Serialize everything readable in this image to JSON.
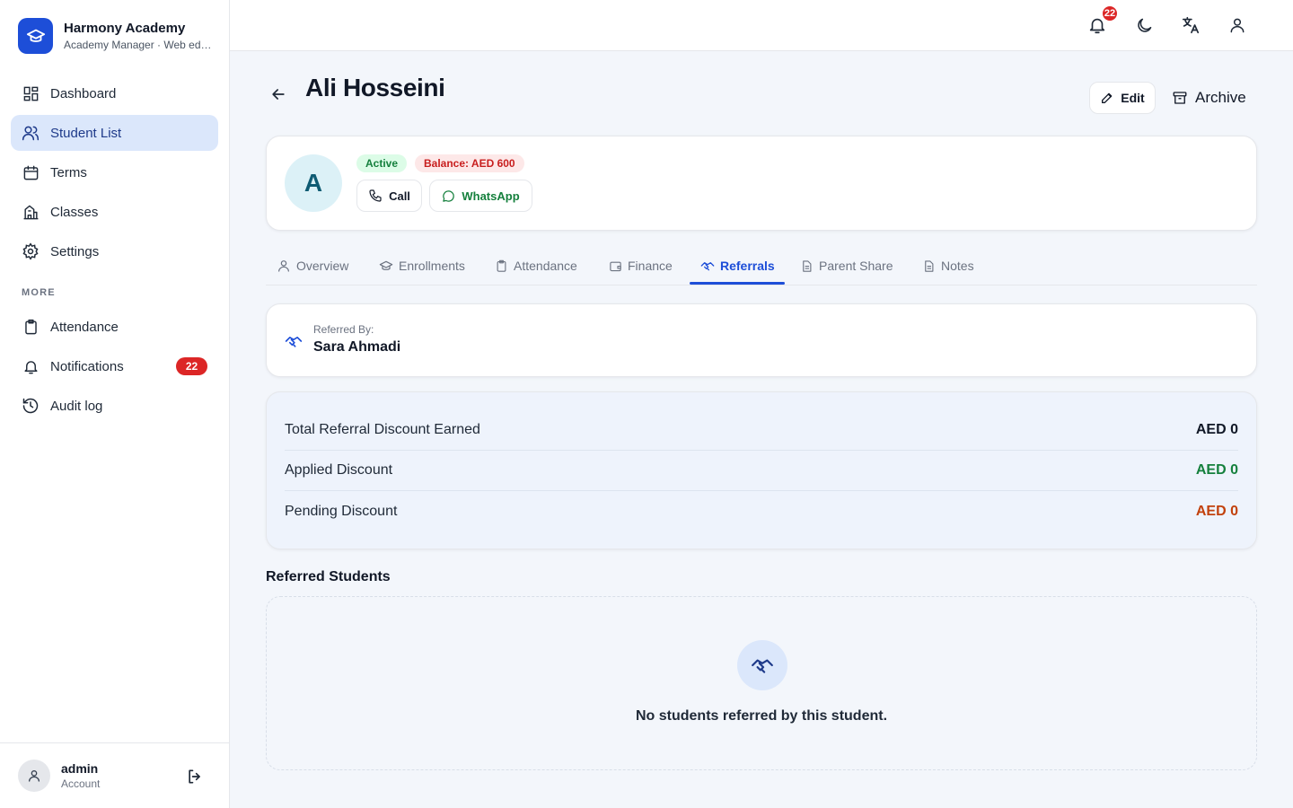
{
  "brand": {
    "title": "Harmony Academy",
    "subtitle": "Academy Manager · Web editor",
    "accent": "#1d4ed8"
  },
  "sidebar": {
    "items": [
      {
        "label": "Dashboard",
        "icon": "dashboard-icon"
      },
      {
        "label": "Student List",
        "icon": "users-icon",
        "active": true
      },
      {
        "label": "Terms",
        "icon": "calendar-icon"
      },
      {
        "label": "Classes",
        "icon": "building-icon"
      },
      {
        "label": "Settings",
        "icon": "gear-icon"
      }
    ],
    "more_label": "MORE",
    "more_items": [
      {
        "label": "Attendance",
        "icon": "clipboard-icon"
      },
      {
        "label": "Notifications",
        "icon": "bell-icon",
        "badge": "22"
      },
      {
        "label": "Audit log",
        "icon": "history-icon"
      }
    ]
  },
  "account": {
    "name": "admin",
    "role": "Account"
  },
  "topbar": {
    "notification_count": "22",
    "icons": [
      "bell-icon",
      "moon-icon",
      "translate-icon",
      "user-icon"
    ]
  },
  "student": {
    "name": "Ali Hosseini",
    "initial": "A",
    "status": "Active",
    "balance": "Balance: AED 600"
  },
  "actions": {
    "edit": "Edit",
    "archive": "Archive",
    "call": "Call",
    "whatsapp": "WhatsApp"
  },
  "tabs": [
    {
      "label": "Overview",
      "icon": "user-icon"
    },
    {
      "label": "Enrollments",
      "icon": "graduation-cap-icon"
    },
    {
      "label": "Attendance",
      "icon": "clipboard-icon"
    },
    {
      "label": "Finance",
      "icon": "wallet-icon"
    },
    {
      "label": "Referrals",
      "icon": "handshake-icon",
      "active": true
    },
    {
      "label": "Parent Share",
      "icon": "document-icon"
    },
    {
      "label": "Notes",
      "icon": "document-icon"
    }
  ],
  "referrals": {
    "referred_by_label": "Referred By:",
    "referred_by_name": "Sara Ahmadi",
    "summary": [
      {
        "label": "Total Referral Discount Earned",
        "value": "AED 0",
        "color": "#111827"
      },
      {
        "label": "Applied Discount",
        "value": "AED 0",
        "color": "#15803d"
      },
      {
        "label": "Pending Discount",
        "value": "AED 0",
        "color": "#c2410c"
      }
    ],
    "referred_students_title": "Referred Students",
    "empty_text": "No students referred by this student."
  }
}
